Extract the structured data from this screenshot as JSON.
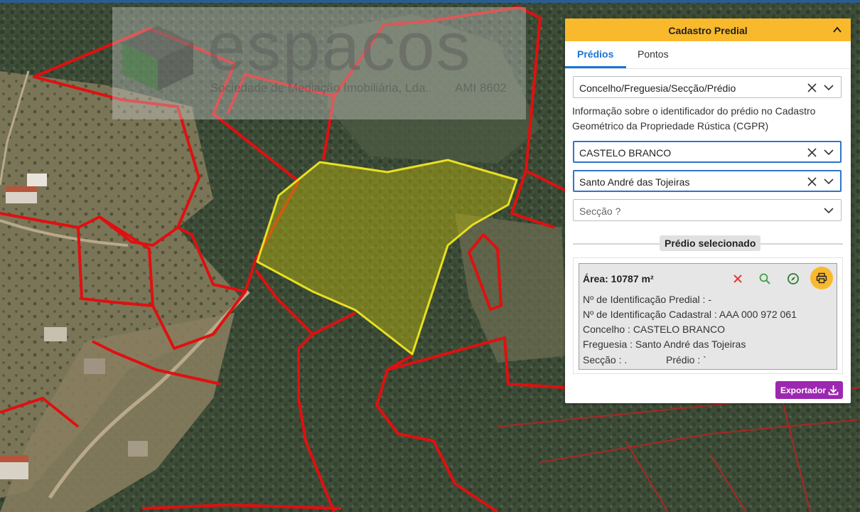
{
  "watermark": {
    "title": "espacos",
    "subtitle": "Sociedade de Mediação Imobiliária, Lda.",
    "license": "AMI 8602"
  },
  "panel": {
    "title": "Cadastro Predial",
    "tabs": [
      {
        "label": "Prédios",
        "active": true
      },
      {
        "label": "Pontos",
        "active": false
      }
    ],
    "search_field": {
      "value": "Concelho/Freguesia/Secção/Prédio"
    },
    "info_text": "Informação sobre o identificador do prédio no Cadastro Geométrico da Propriedade Rústica (CGPR)",
    "concelho_field": {
      "value": "CASTELO BRANCO"
    },
    "freguesia_field": {
      "value": "Santo André das Tojeiras"
    },
    "seccao_field": {
      "placeholder": "Secção ?"
    },
    "selected_label": "Prédio selecionado",
    "result": {
      "area": "Área: 10787 m²",
      "lines": [
        "Nº de Identificação Predial : -",
        "Nº de Identificação Cadastral : AAA 000 972 061",
        "Concelho : CASTELO BRANCO",
        "Freguesia : Santo André das Tojeiras",
        "Secção : ."
      ],
      "predio": "Prédio : `"
    },
    "export_label": "Exportador"
  },
  "colors": {
    "accent": "#f8b92d",
    "tab_active": "#1976d2",
    "parcel_border": "#e01010",
    "selected_parcel": "#e8e020",
    "export": "#9c27b0",
    "delete": "#e53935",
    "zoom": "#43a047",
    "locate": "#2e7d32"
  },
  "icons": [
    "chevron-up-icon",
    "close-icon",
    "chevron-down-icon",
    "search-icon",
    "compass-icon",
    "print-icon",
    "download-icon"
  ]
}
